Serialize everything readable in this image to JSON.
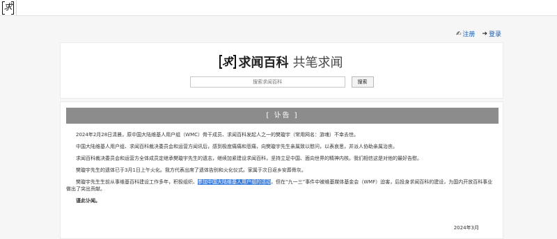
{
  "topbar": {
    "logo_text": "求"
  },
  "user_links": {
    "register": "注册",
    "login": "登录"
  },
  "header": {
    "logo_mark": "求",
    "site_name": "求闻百科",
    "slogan": "共笔求闻",
    "search_placeholder": "搜索求闻百科",
    "search_button": "搜索"
  },
  "notice": {
    "title": "[ 讣告 ]",
    "paragraphs": {
      "p1": "2024年2月28日清晨，原中国大陆维基人用户组（WMC）骨干成员、求闻百科发起人之一的樊璇宇（常用网名：游魂）不幸去世。",
      "p2": "中国大陆维基人用户组、求闻百科裁决委员会和运营方闻讯后，感到极度痛痛和悲痛，向樊璇宇先生亲属致以慰问，以表哀思，并派人协助亲属治丧。",
      "p3": "求闻百科裁决委员会和运营方全体成员定继承樊璇宇先生的遗志，继续加紧建设求闻百科，坚持立足中国、面向世界的精神内核。我们相信这是对他的最好告慰。",
      "p4": "樊璇宇先生的遗体已于3月1日上午火化。我方代表出席了遗体告别和火化仪式。家属于次日返乡安葬骨灰。",
      "p5_a": "樊璇宇先生生前从事维基百科建设工作多年，积极组织、",
      "p5_highlight": "参加中国大陆维基人用户组的活动",
      "p5_b": "，但在“九一三”事件中被维基媒体基金会（WMF）迫害，后投身求闻百科的建设，为国内开放百科事业做出了突出贡献。",
      "p6": "谨此讣闻。"
    },
    "date": "2024年3月"
  }
}
